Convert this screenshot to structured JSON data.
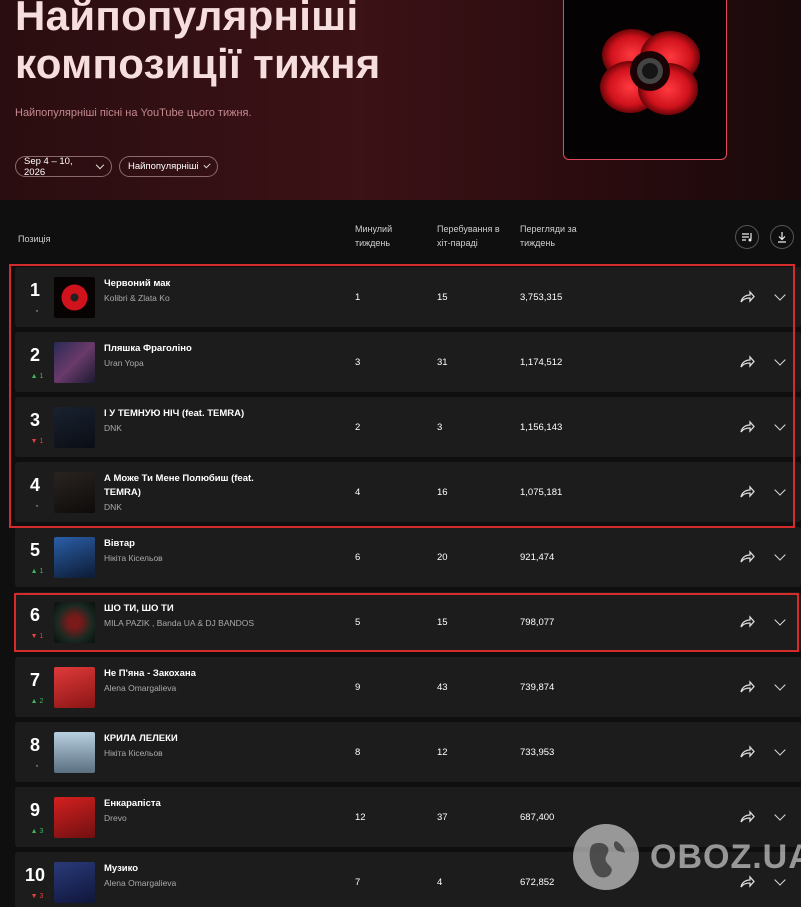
{
  "header": {
    "title_line1": "Найпопулярніші",
    "title_line2": "композиції тижня",
    "subtitle": "Найпопулярніші пісні на YouTube цього тижня.",
    "date_filter": "Sep 4 – 10, 2026",
    "category_filter": "Найпопулярніші"
  },
  "table": {
    "col_position": "Позиція",
    "col_last_week": "Минулий тиждень",
    "col_weeks": "Перебування в хіт-параді",
    "col_views": "Перегляди за тиждень"
  },
  "rows": [
    {
      "rank": "1",
      "delta": "",
      "title": "Червоний мак",
      "title2": "",
      "artist": "Kolibri & Zlata Ko",
      "last": "1",
      "weeks": "15",
      "views": "3,753,315"
    },
    {
      "rank": "2",
      "delta": "▲ 1",
      "title": "Пляшка Фраголіно",
      "title2": "",
      "artist": "Uran Yopa",
      "last": "3",
      "weeks": "31",
      "views": "1,174,512"
    },
    {
      "rank": "3",
      "delta": "▼ 1",
      "title": "І У ТЕМНУЮ НІЧ (feat. TEMRA)",
      "title2": "",
      "artist": "DNK",
      "last": "2",
      "weeks": "3",
      "views": "1,156,143"
    },
    {
      "rank": "4",
      "delta": "",
      "title": "А Може Ти Мене Полюбиш (feat.",
      "title2": "TEMRA)",
      "artist": "DNK",
      "last": "4",
      "weeks": "16",
      "views": "1,075,181"
    },
    {
      "rank": "5",
      "delta": "▲ 1",
      "title": "Вівтар",
      "title2": "",
      "artist": "Нікіта Кісельов",
      "last": "6",
      "weeks": "20",
      "views": "921,474"
    },
    {
      "rank": "6",
      "delta": "▼ 1",
      "title": "ШО ТИ, ШО ТИ",
      "title2": "",
      "artist": "MILA PAZIK , Banda UA & DJ BANDOS",
      "last": "5",
      "weeks": "15",
      "views": "798,077"
    },
    {
      "rank": "7",
      "delta": "▲ 2",
      "title": "Не П'яна - Закохана",
      "title2": "",
      "artist": "Alena Omargalieva",
      "last": "9",
      "weeks": "43",
      "views": "739,874"
    },
    {
      "rank": "8",
      "delta": "",
      "title": "КРИЛА ЛЕЛЕКИ",
      "title2": "",
      "artist": "Нікіта Кісельов",
      "last": "8",
      "weeks": "12",
      "views": "733,953"
    },
    {
      "rank": "9",
      "delta": "▲ 3",
      "title": "Енкарапіста",
      "title2": "",
      "artist": "Drevo",
      "last": "12",
      "weeks": "37",
      "views": "687,400"
    },
    {
      "rank": "10",
      "delta": "▼ 3",
      "title": "Музико",
      "title2": "",
      "artist": "Alena Omargalieva",
      "last": "7",
      "weeks": "4",
      "views": "672,852"
    }
  ],
  "watermark": "OBOZ.UA",
  "colors": {
    "accent": "#d52b2b",
    "up": "#3fb55a",
    "down": "#e5413d"
  }
}
